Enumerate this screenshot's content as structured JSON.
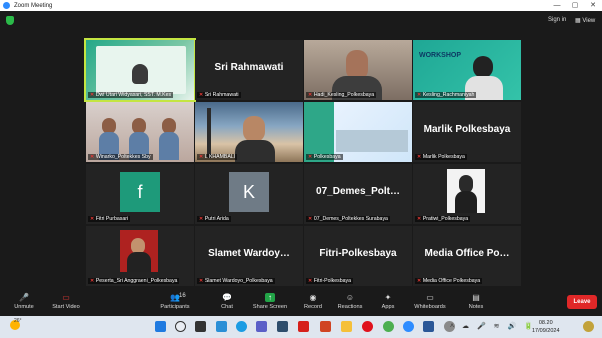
{
  "window": {
    "title": "Zoom Meeting",
    "controls": [
      "—",
      "▢",
      "✕"
    ]
  },
  "topbar": {
    "signin": "Sign in",
    "view": "View"
  },
  "tiles": [
    {
      "name": "Dwi Utari Widyasari, SST. M.Kes",
      "kind": "video"
    },
    {
      "name": "Sri Rahmawati",
      "kind": "name",
      "big": "Sri Rahmawati"
    },
    {
      "name": "Hadi_Kesling_Polkesbaya",
      "kind": "video"
    },
    {
      "name": "Kesling_Rachmaniyah",
      "kind": "video",
      "slide_text": "WORKSHOP"
    },
    {
      "name": "Winarko_Poltekkes Sby",
      "kind": "video"
    },
    {
      "name": "L KHAMBALI",
      "kind": "video"
    },
    {
      "name": "Polkesbaya",
      "kind": "video"
    },
    {
      "name": "Marlik Polkesbaya",
      "kind": "name",
      "big": "Marlik Polkesbaya"
    },
    {
      "name": "Fitri Purbasari",
      "kind": "avatar",
      "letter": "f"
    },
    {
      "name": "Putri Arida",
      "kind": "avatar",
      "letter": "K"
    },
    {
      "name": "07_Demes_Poltekkes Surabaya",
      "kind": "name",
      "big": "07_Demes_Polt…"
    },
    {
      "name": "Pratiwi_Polkesbaya",
      "kind": "photo"
    },
    {
      "name": "Peserta_Sri Anggraeni_Polkesbaya",
      "kind": "photo"
    },
    {
      "name": "Slamet Wardoyo_Polkesbaya",
      "kind": "name",
      "big": "Slamet Wardoy…"
    },
    {
      "name": "Fitri-Polkesbaya",
      "kind": "name",
      "big": "Fitri-Polkesbaya"
    },
    {
      "name": "Media Office Polkesbaya",
      "kind": "name",
      "big": "Media Office Po…"
    }
  ],
  "toolbar": {
    "unmute": "Unmute",
    "start_video": "Start Video",
    "participants": "Participants",
    "participants_count": "16",
    "chat": "Chat",
    "share_screen": "Share Screen",
    "record": "Record",
    "reactions": "Reactions",
    "apps": "Apps",
    "whiteboards": "Whiteboards",
    "notes": "Notes",
    "leave": "Leave"
  },
  "taskbar": {
    "temperature": "26°",
    "time": "08.20",
    "date": "17/09/2024",
    "icons": [
      "windows-icon",
      "search-icon",
      "taskview-icon",
      "widgets-icon",
      "edge-icon",
      "teams-icon",
      "camera-icon",
      "acrobat-icon",
      "powerpoint-icon",
      "files-icon",
      "opera-icon",
      "chrome-icon",
      "zoom-icon",
      "word-icon",
      "settings-icon",
      "zoom-meeting-icon"
    ]
  },
  "colors": {
    "active_speaker": "#c4e542",
    "leave": "#e02828",
    "share": "#22a447"
  }
}
